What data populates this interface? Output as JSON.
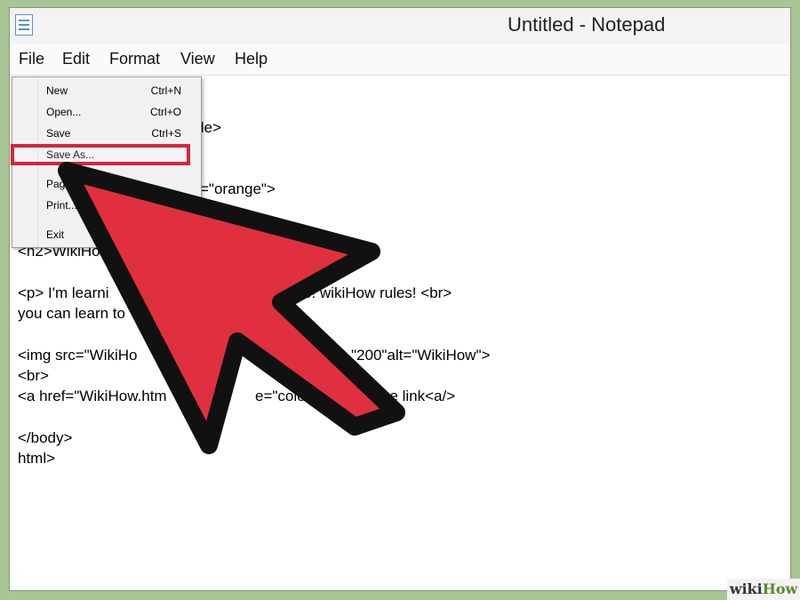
{
  "window": {
    "title": "Untitled - Notepad",
    "app_icon": "notepad-icon"
  },
  "menubar": {
    "items": [
      "File",
      "Edit",
      "Format",
      "View",
      "Help"
    ]
  },
  "file_menu": {
    "items": [
      {
        "label": "New",
        "shortcut": "Ctrl+N"
      },
      {
        "label": "Open...",
        "shortcut": "Ctrl+O"
      },
      {
        "label": "Save",
        "shortcut": "Ctrl+S"
      },
      {
        "label": "Save As...",
        "shortcut": ""
      },
      {
        "label": "Page",
        "shortcut": ""
      },
      {
        "label": "Print...",
        "shortcut": ""
      },
      {
        "label": "Exit",
        "shortcut": ""
      }
    ],
    "highlighted": "Save As...",
    "highlight_color": "#d6253e"
  },
  "editor": {
    "lines": [
      "tle>",
      "=\"orange\">",
      "<h2>WikiHo",
      "<p> I'm learni",
      "e! wikiHow rules! <br>",
      "you can learn to",
      "<img src=\"WikiHo",
      "\"200\"alt=\"WikiHow\">",
      "<br>",
      "<a href=\"WikiHow.htm",
      "e=\"colo",
      "k the link<a/>",
      "</body>",
      "html>"
    ]
  },
  "pointer": {
    "icon": "arrow-pointer-icon",
    "color": "#e0303f"
  },
  "watermark": {
    "prefix": "wiki",
    "suffix": "How"
  }
}
